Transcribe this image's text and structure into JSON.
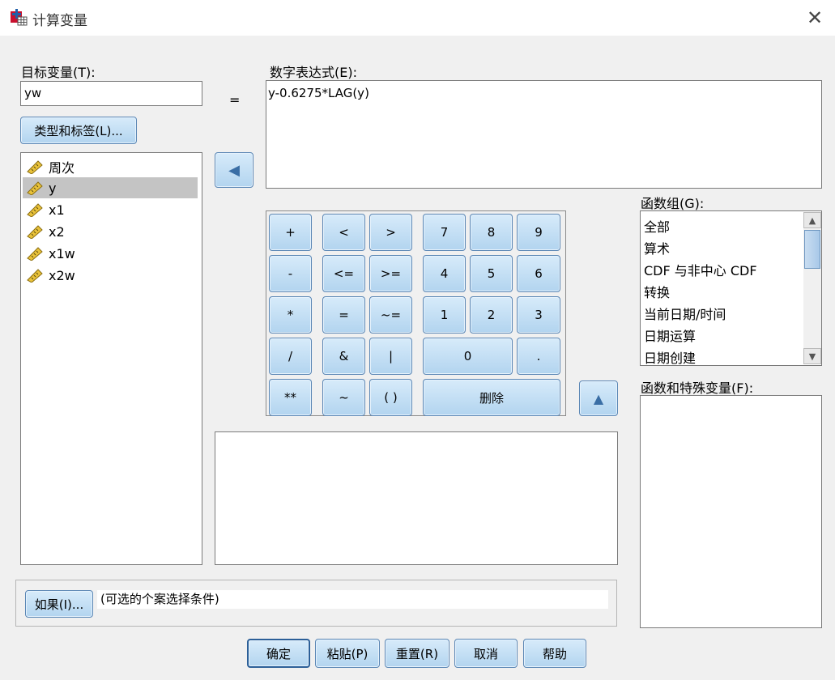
{
  "window": {
    "title": "计算变量",
    "close_glyph": "✕"
  },
  "target": {
    "label": "目标变量(T):",
    "value": "yw",
    "type_label_button": "类型和标签(L)..."
  },
  "equals": "=",
  "expression": {
    "label": "数字表达式(E):",
    "value": "y-0.6275*LAG(y)"
  },
  "variables": [
    "周次",
    "y",
    "x1",
    "x2",
    "x1w",
    "x2w"
  ],
  "selected_variable": "y",
  "move_left_glyph": "◀",
  "keypad": {
    "keys": [
      "+",
      "<",
      ">",
      "7",
      "8",
      "9",
      "-",
      "<=",
      ">=",
      "4",
      "5",
      "6",
      "*",
      "=",
      "~=",
      "1",
      "2",
      "3",
      "/",
      "&",
      "|",
      "0",
      ".",
      "**",
      "~",
      "( )",
      "删除"
    ]
  },
  "move_up_glyph": "▲",
  "function_group": {
    "label": "函数组(G):",
    "items": [
      "全部",
      "算术",
      "CDF 与非中心 CDF",
      "转换",
      "当前日期/时间",
      "日期运算",
      "日期创建"
    ]
  },
  "functions_label": "函数和特殊变量(F):",
  "if_section": {
    "button": "如果(I)...",
    "condition": "(可选的个案选择条件)"
  },
  "footer": {
    "ok": "确定",
    "paste": "粘贴(P)",
    "reset": "重置(R)",
    "cancel": "取消",
    "help": "帮助"
  },
  "colors": {
    "button_top": "#d7ebfa",
    "button_bottom": "#b2d4ef",
    "button_border": "#5b87b5",
    "selection": "#c4c4c4"
  }
}
